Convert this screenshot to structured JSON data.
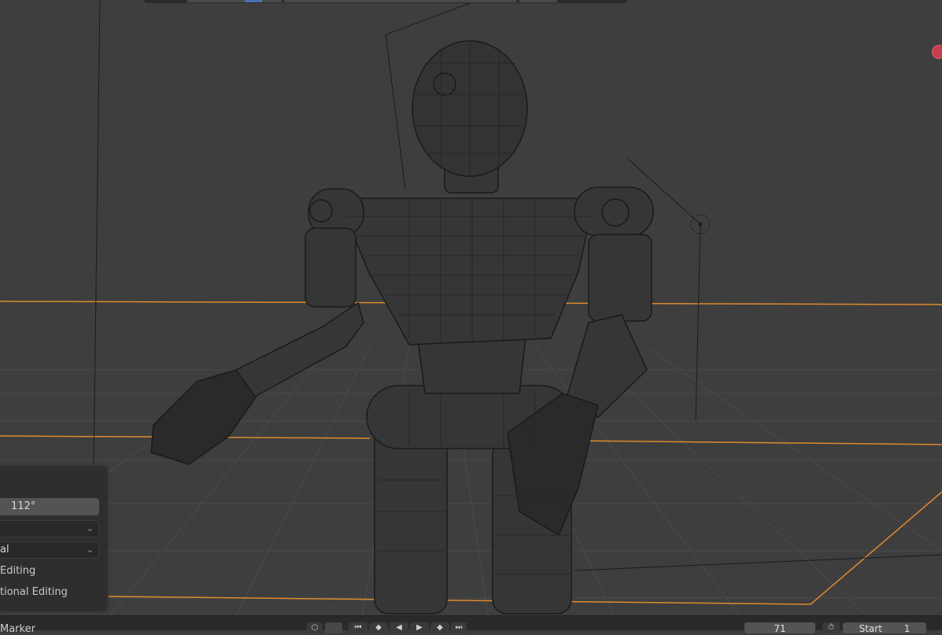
{
  "operator_panel": {
    "angle_value": "112°",
    "select_1": "",
    "select_2": "al",
    "option_1": "Editing",
    "option_2": "tional Editing"
  },
  "timeline": {
    "marker_label": "Marker",
    "current_frame": "71",
    "start_label": "Start",
    "start_value": "1"
  },
  "icons": {
    "view_object": "circle-icon",
    "camera": "camera-icon",
    "jump_start": "jump-to-start-icon",
    "prev_keyframe": "previous-keyframe-icon",
    "play_reverse": "play-reverse-icon",
    "play": "play-icon",
    "next_keyframe": "next-keyframe-icon",
    "jump_end": "jump-to-end-icon",
    "stopwatch": "stopwatch-icon"
  },
  "colors": {
    "viewport_bg": "#3e3e3e",
    "grid_line": "#4a4a4a",
    "axis_highlight": "#e08a2e",
    "wire": "#1a1a1a",
    "gizmo": "#c2404f"
  }
}
